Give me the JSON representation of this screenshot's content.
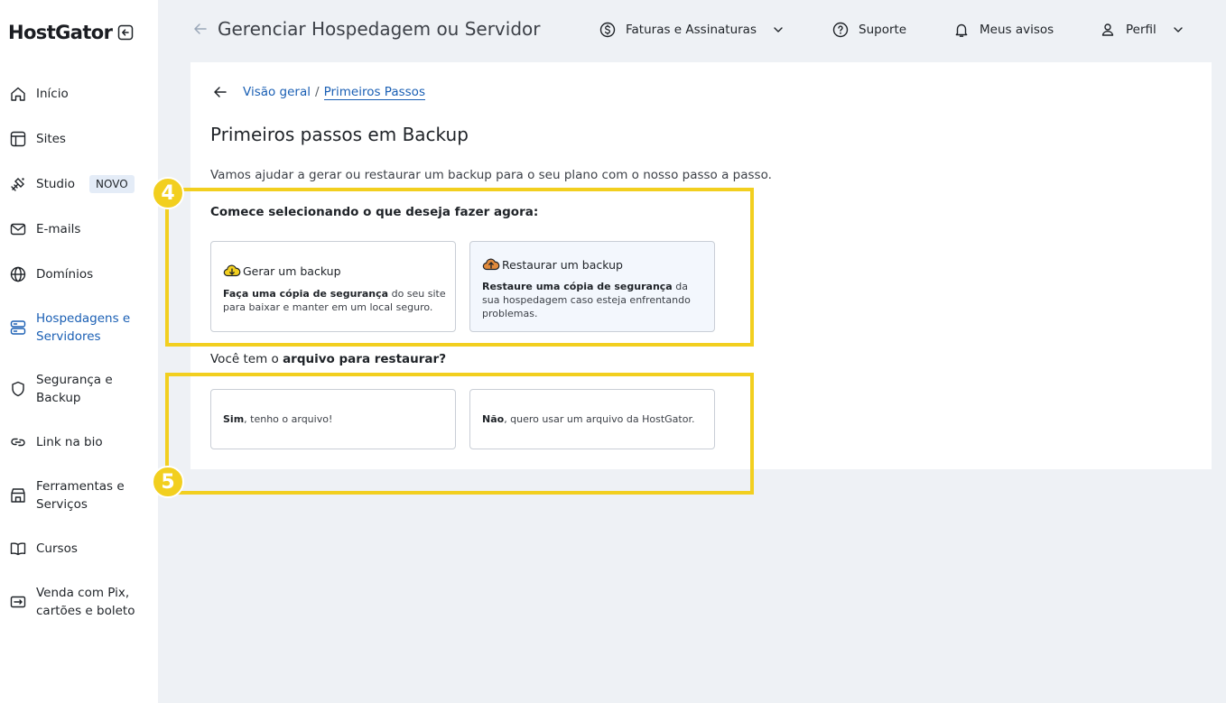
{
  "brand": {
    "name": "HostGator"
  },
  "sidebar": {
    "items": [
      {
        "label": "Início",
        "icon": "home-icon"
      },
      {
        "label": "Sites",
        "icon": "layout-icon"
      },
      {
        "label": "Studio",
        "icon": "studio-icon",
        "badge": "NOVO"
      },
      {
        "label": "E-mails",
        "icon": "mail-icon"
      },
      {
        "label": "Domínios",
        "icon": "globe-icon"
      },
      {
        "label": "Hospedagens e Servidores",
        "icon": "server-icon",
        "active": true
      },
      {
        "label": "Segurança e Backup",
        "icon": "shield-icon"
      },
      {
        "label": "Link na bio",
        "icon": "link-icon"
      },
      {
        "label": "Ferramentas e Serviços",
        "icon": "store-icon"
      },
      {
        "label": "Cursos",
        "icon": "book-icon"
      },
      {
        "label": "Venda com Pix, cartões e boleto",
        "icon": "payment-icon"
      }
    ]
  },
  "header": {
    "title": "Gerenciar Hospedagem ou Servidor",
    "links": {
      "billing": "Faturas e Assinaturas",
      "support": "Suporte",
      "notices": "Meus avisos",
      "profile": "Perfil"
    }
  },
  "content": {
    "breadcrumb": {
      "parent": "Visão geral",
      "separator": "/",
      "current": "Primeiros Passos"
    },
    "title": "Primeiros passos em Backup",
    "intro": "Vamos ajudar a gerar ou restaurar um backup para o seu plano com o nosso passo a passo.",
    "question1": "Comece selecionando o que deseja fazer agora:",
    "option_generate": {
      "title": "Gerar um backup",
      "desc_bold": "Faça uma cópia de segurança",
      "desc_rest": " do seu site para baixar e manter em um local seguro."
    },
    "option_restore": {
      "title": "Restaurar um backup",
      "desc_bold": "Restaure uma cópia de segurança",
      "desc_rest": " da sua hospedagem caso esteja enfrentando problemas."
    },
    "question2_prefix": "Você tem o ",
    "question2_bold": "arquivo para restaurar?",
    "option_yes": {
      "bold": "Sim",
      "rest": ", tenho o arquivo!"
    },
    "option_no": {
      "bold": "Não",
      "rest": ", quero usar um arquivo da HostGator."
    }
  },
  "annotations": {
    "step4": "4",
    "step5": "5"
  },
  "colors": {
    "accent": "#1a5fb4",
    "highlight": "#f2cf1f",
    "background": "#eef1f5"
  }
}
